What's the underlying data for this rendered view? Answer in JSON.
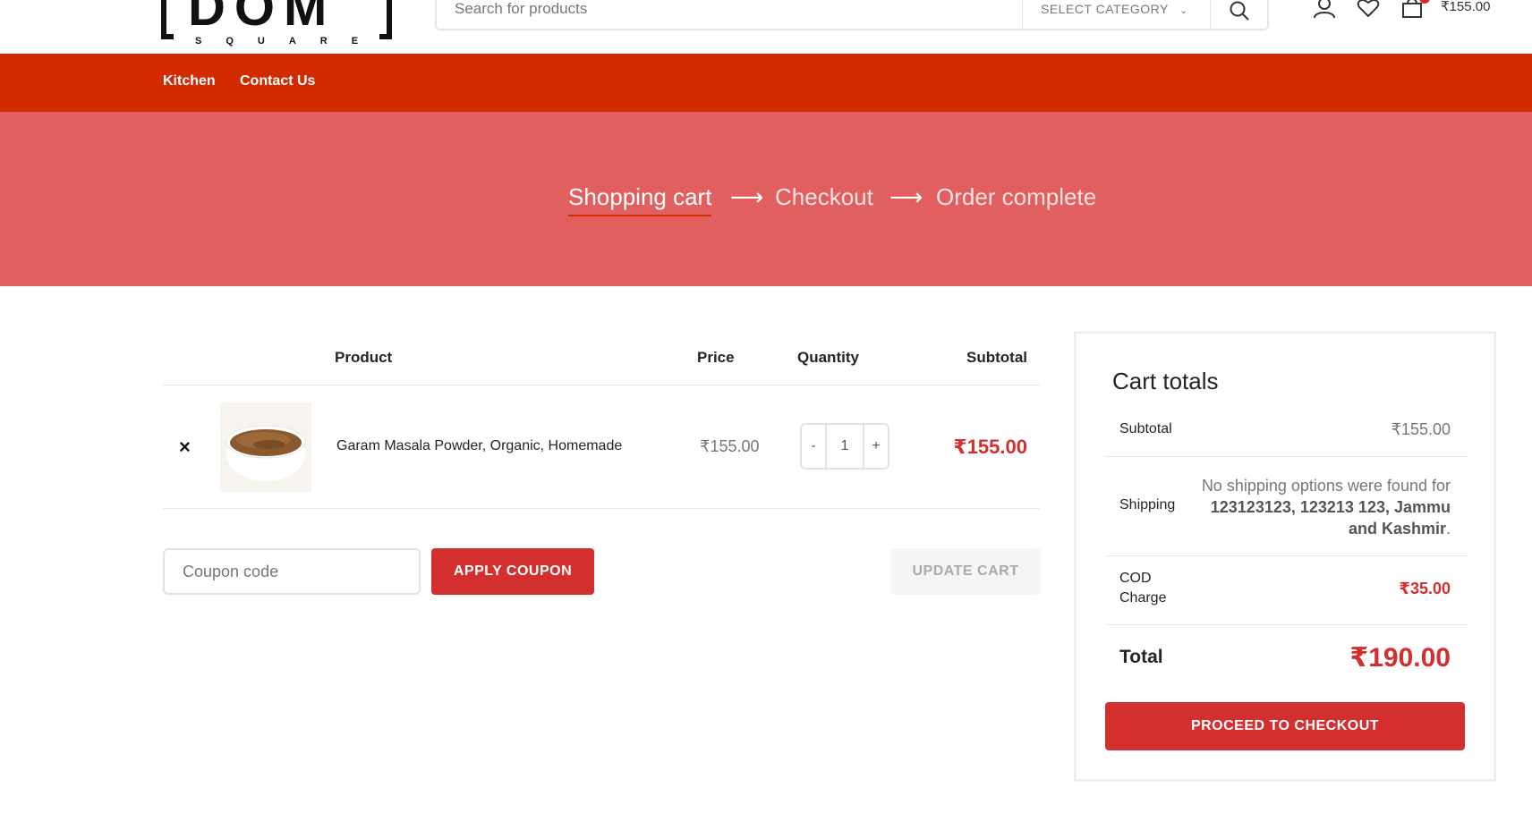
{
  "header": {
    "logo_word": "DOM",
    "logo_sub": "SQUARE",
    "search_placeholder": "Search for products",
    "category_label": "SELECT CATEGORY",
    "cart_total": "₹155.00"
  },
  "nav": {
    "items": [
      {
        "label": "Kitchen"
      },
      {
        "label": "Contact Us"
      }
    ]
  },
  "hero": {
    "steps": [
      {
        "label": "Shopping cart",
        "active": true
      },
      {
        "label": "Checkout",
        "active": false
      },
      {
        "label": "Order complete",
        "active": false
      }
    ],
    "arrow": "⟶"
  },
  "cart": {
    "headers": {
      "product": "Product",
      "price": "Price",
      "quantity": "Quantity",
      "subtotal": "Subtotal"
    },
    "items": [
      {
        "name": "Garam Masala Powder, Organic, Homemade",
        "price": "₹155.00",
        "quantity": "1",
        "subtotal": "₹155.00"
      }
    ],
    "remove_symbol": "×",
    "qty_minus": "-",
    "qty_plus": "+",
    "coupon_placeholder": "Coupon code",
    "apply_coupon": "APPLY COUPON",
    "update_cart": "UPDATE CART"
  },
  "totals": {
    "title": "Cart totals",
    "subtotal_label": "Subtotal",
    "subtotal_value": "₹155.00",
    "shipping_label": "Shipping",
    "shipping_msg_pre": "No shipping options were found for ",
    "shipping_address": "123123123, 123213 123, Jammu and Kashmir",
    "shipping_msg_post": ".",
    "cod_label_1": "COD",
    "cod_label_2": "Charge",
    "cod_value": "₹35.00",
    "total_label": "Total",
    "total_value": "₹190.00",
    "checkout_button": "PROCEED TO CHECKOUT"
  },
  "colors": {
    "nav_bg": "#d22b00",
    "hero_bg": "#e25f60",
    "accent": "#d32f2f"
  }
}
